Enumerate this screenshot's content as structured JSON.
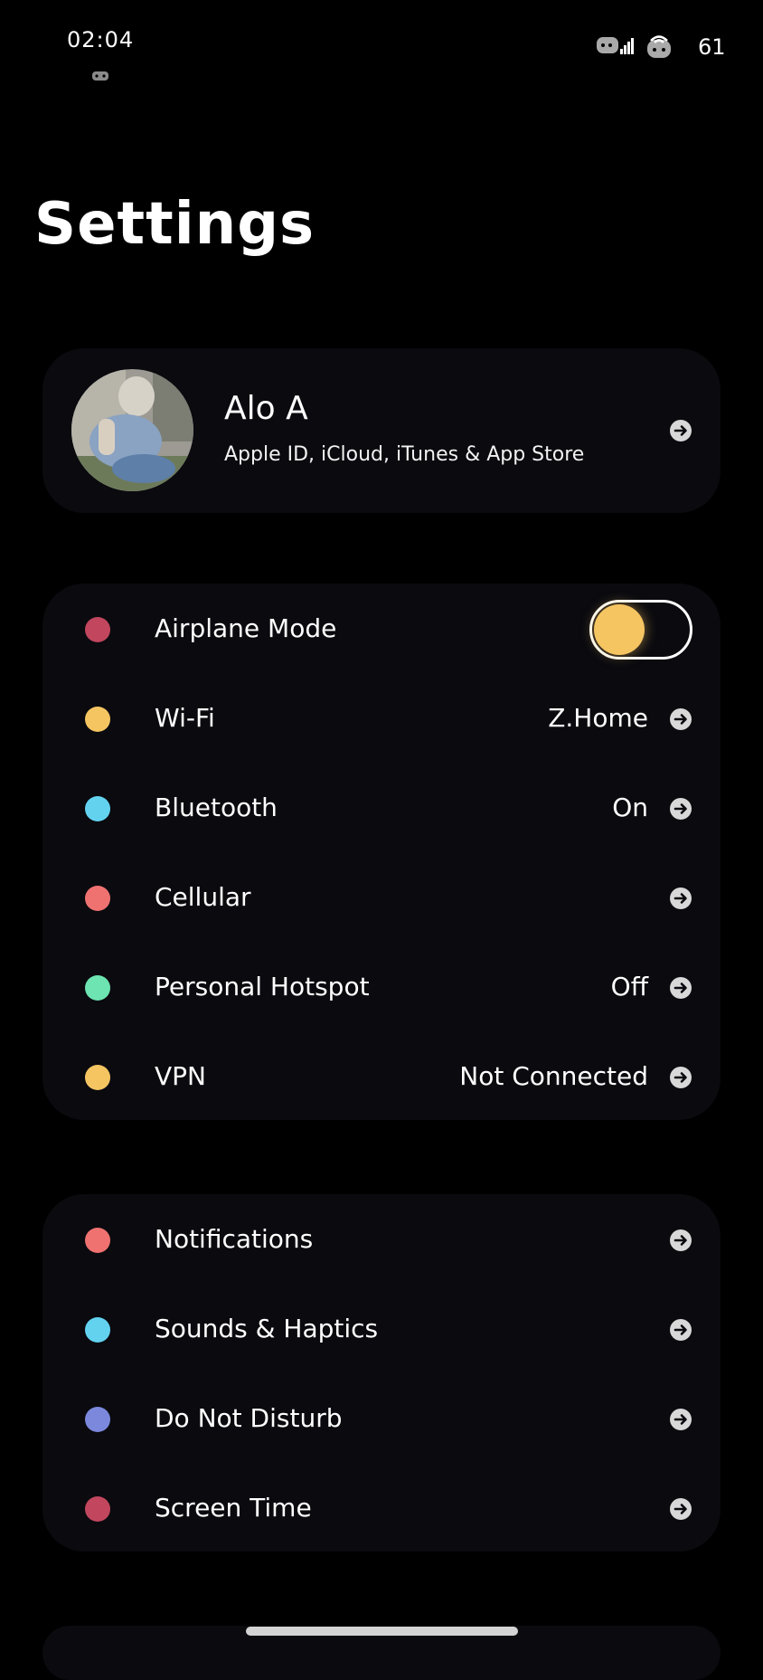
{
  "status_bar": {
    "time": "02:04",
    "battery": "61"
  },
  "header": {
    "title": "Settings"
  },
  "profile": {
    "name": "Alo A",
    "subtitle": "Apple ID, iCloud, iTunes & App Store"
  },
  "connectivity": {
    "airplane_mode": {
      "label": "Airplane Mode",
      "dot_color": "#c1465e",
      "toggle_on": false,
      "knob_color": "#f5c562"
    },
    "wifi": {
      "label": "Wi-Fi",
      "value": "Z.Home",
      "dot_color": "#f5c562"
    },
    "bluetooth": {
      "label": "Bluetooth",
      "value": "On",
      "dot_color": "#62d2ef"
    },
    "cellular": {
      "label": "Cellular",
      "value": "",
      "dot_color": "#ef7271"
    },
    "hotspot": {
      "label": "Personal Hotspot",
      "value": "Off",
      "dot_color": "#6de4b1"
    },
    "vpn": {
      "label": "VPN",
      "value": "Not Connected",
      "dot_color": "#f5c562"
    }
  },
  "general": {
    "notifications": {
      "label": "Notifications",
      "dot_color": "#ef7271"
    },
    "sounds": {
      "label": "Sounds & Haptics",
      "dot_color": "#62d2ef"
    },
    "dnd": {
      "label": "Do Not Disturb",
      "dot_color": "#7b88dc"
    },
    "screen_time": {
      "label": "Screen Time",
      "dot_color": "#c1465e"
    }
  },
  "icons": {
    "row_arrow": "arrow-right-circle-icon",
    "cell": "cellular-signal-icon",
    "wifi": "wifi-icon"
  }
}
